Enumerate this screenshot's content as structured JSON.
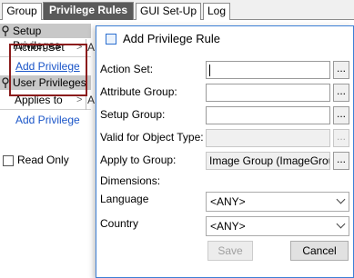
{
  "tabs": [
    {
      "label": "Group"
    },
    {
      "label": "Privilege Rules"
    },
    {
      "label": "GUI Set-Up"
    },
    {
      "label": "Log"
    }
  ],
  "left_panel": {
    "setup_privileges": {
      "title": "Setup Privileges",
      "row_label": "Action Set",
      "row_trunc": "A",
      "add_link": "Add Privilege"
    },
    "user_privileges": {
      "title": "User Privileges",
      "row_label": "Applies to",
      "row_trunc": "A",
      "add_link": "Add Privilege"
    },
    "read_only_label": "Read Only"
  },
  "dialog": {
    "title": "Add Privilege Rule",
    "fields": {
      "action_set": {
        "label": "Action Set:",
        "value": ""
      },
      "attribute_group": {
        "label": "Attribute Group:",
        "value": ""
      },
      "setup_group": {
        "label": "Setup Group:",
        "value": ""
      },
      "valid_for_object_type": {
        "label": "Valid for Object Type:",
        "value": ""
      },
      "apply_to_group": {
        "label": "Apply to Group:",
        "value": "Image Group (ImageGroup)"
      }
    },
    "browse_label": "...",
    "dimensions_label": "Dimensions:",
    "language": {
      "label": "Language",
      "value": "<ANY>"
    },
    "country": {
      "label": "Country",
      "value": "<ANY>"
    },
    "save_label": "Save",
    "cancel_label": "Cancel"
  },
  "colors": {
    "active_tab": "#5a5a5a",
    "section_header": "#c8c8c8",
    "link": "#1a55c8",
    "highlight_border": "#8b1c1c",
    "dialog_border": "#3c7fd6"
  }
}
